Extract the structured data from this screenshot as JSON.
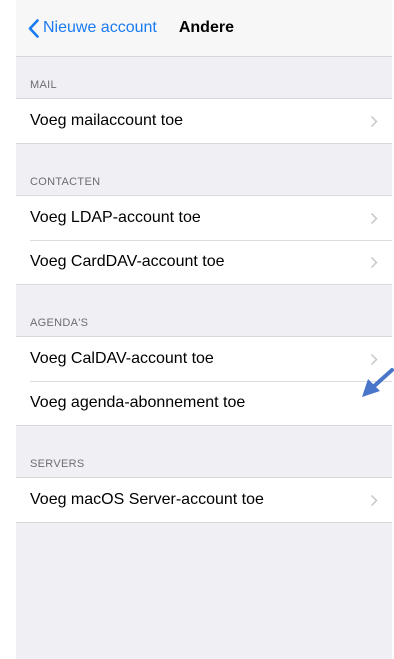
{
  "navbar": {
    "back_label": "Nieuwe account",
    "title": "Andere"
  },
  "sections": [
    {
      "header": "MAIL",
      "rows": [
        {
          "label": "Voeg mailaccount toe",
          "chevron": true
        }
      ]
    },
    {
      "header": "CONTACTEN",
      "rows": [
        {
          "label": "Voeg LDAP-account toe",
          "chevron": true
        },
        {
          "label": "Voeg CardDAV-account toe",
          "chevron": true
        }
      ]
    },
    {
      "header": "AGENDA'S",
      "rows": [
        {
          "label": "Voeg CalDAV-account toe",
          "chevron": true
        },
        {
          "label": "Voeg agenda-abonnement toe",
          "chevron": false
        }
      ]
    },
    {
      "header": "SERVERS",
      "rows": [
        {
          "label": "Voeg macOS Server-account toe",
          "chevron": true
        }
      ]
    }
  ],
  "colors": {
    "accent": "#1a7bf0",
    "annotation_arrow": "#4a76c9"
  },
  "icons": {
    "back": "chevron-left-icon",
    "disclosure": "chevron-right-icon",
    "annotation": "arrow-icon"
  }
}
